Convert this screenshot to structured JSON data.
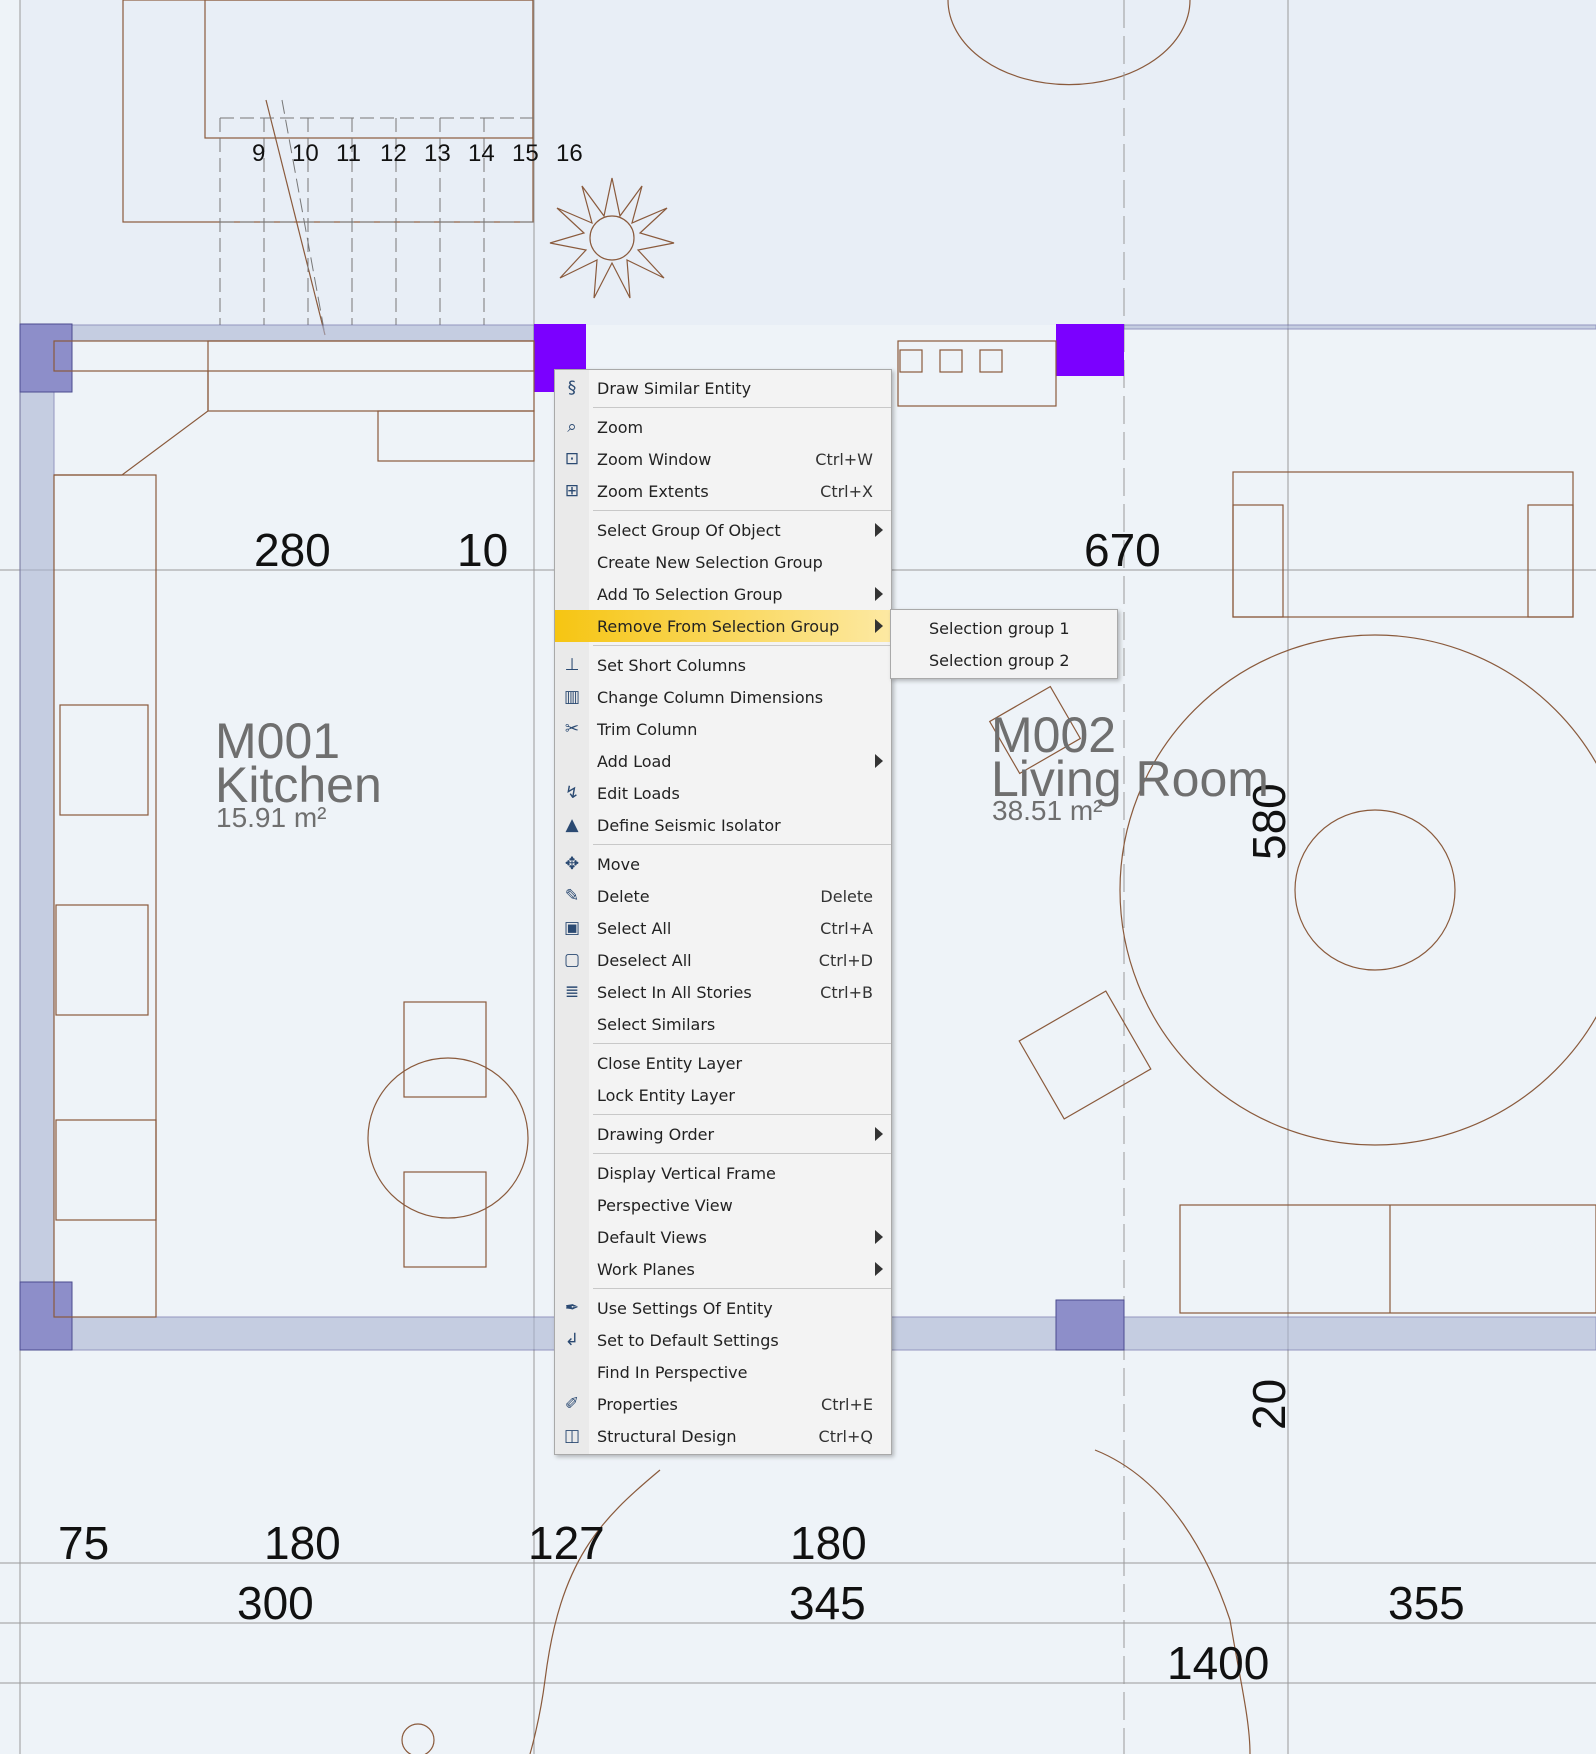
{
  "plan": {
    "stair_numbers": [
      "9",
      "10",
      "11",
      "12",
      "13",
      "14",
      "15",
      "16"
    ],
    "top_dimensions": [
      "280",
      "10",
      "670"
    ],
    "bottom_dimensions_row1": [
      "75",
      "180",
      "127",
      "180"
    ],
    "bottom_dimensions_row2": [
      "300",
      "345",
      "355"
    ],
    "bottom_dimensions_row3": [
      "1400"
    ],
    "vertical_dimensions": [
      "580",
      "20"
    ],
    "rooms": [
      {
        "code": "M001",
        "name": "Kitchen",
        "area": "15.91 m²"
      },
      {
        "code": "M002",
        "name": "Living Room",
        "area": "38.51 m²"
      }
    ],
    "colors": {
      "background": "#eef3f8",
      "lines": "#8a5a3c",
      "column_fill": "#7b00ff",
      "wall_fill": "#9aa6c8"
    }
  },
  "context_menu": {
    "groups": [
      [
        {
          "label": "Draw Similar Entity",
          "icon": "draw-similar-icon"
        }
      ],
      [
        {
          "label": "Zoom",
          "icon": "zoom-icon"
        },
        {
          "label": "Zoom Window",
          "shortcut": "Ctrl+W",
          "icon": "zoom-window-icon"
        },
        {
          "label": "Zoom Extents",
          "shortcut": "Ctrl+X",
          "icon": "zoom-extents-icon"
        }
      ],
      [
        {
          "label": "Select Group Of Object",
          "submenu": true
        },
        {
          "label": "Create New Selection Group"
        },
        {
          "label": "Add To Selection Group",
          "submenu": true
        },
        {
          "label": "Remove From Selection Group",
          "submenu": true,
          "highlighted": true
        }
      ],
      [
        {
          "label": "Set Short Columns",
          "icon": "short-columns-icon"
        },
        {
          "label": "Change Column Dimensions",
          "icon": "column-dimensions-icon"
        },
        {
          "label": "Trim Column",
          "icon": "trim-column-icon"
        },
        {
          "label": "Add Load",
          "submenu": true
        },
        {
          "label": "Edit Loads",
          "icon": "edit-loads-icon"
        },
        {
          "label": "Define Seismic Isolator",
          "icon": "seismic-isolator-icon"
        }
      ],
      [
        {
          "label": "Move",
          "icon": "move-icon"
        },
        {
          "label": "Delete",
          "shortcut": "Delete",
          "icon": "delete-icon"
        },
        {
          "label": "Select All",
          "shortcut": "Ctrl+A",
          "icon": "select-all-icon"
        },
        {
          "label": "Deselect All",
          "shortcut": "Ctrl+D",
          "icon": "deselect-all-icon"
        },
        {
          "label": "Select In All Stories",
          "shortcut": "Ctrl+B",
          "icon": "select-stories-icon"
        },
        {
          "label": "Select Similars"
        }
      ],
      [
        {
          "label": "Close Entity Layer"
        },
        {
          "label": "Lock Entity Layer"
        }
      ],
      [
        {
          "label": "Drawing Order",
          "submenu": true
        }
      ],
      [
        {
          "label": "Display Vertical Frame"
        },
        {
          "label": "Perspective View"
        },
        {
          "label": "Default Views",
          "submenu": true
        },
        {
          "label": "Work Planes",
          "submenu": true
        }
      ],
      [
        {
          "label": "Use Settings Of Entity",
          "icon": "eyedropper-icon"
        },
        {
          "label": "Set to Default Settings",
          "icon": "default-settings-icon"
        },
        {
          "label": "Find In Perspective"
        },
        {
          "label": "Properties",
          "shortcut": "Ctrl+E",
          "icon": "properties-icon"
        },
        {
          "label": "Structural Design",
          "shortcut": "Ctrl+Q",
          "icon": "structural-design-icon"
        }
      ]
    ],
    "submenu_items": [
      "Selection group 1",
      "Selection group 2"
    ]
  }
}
